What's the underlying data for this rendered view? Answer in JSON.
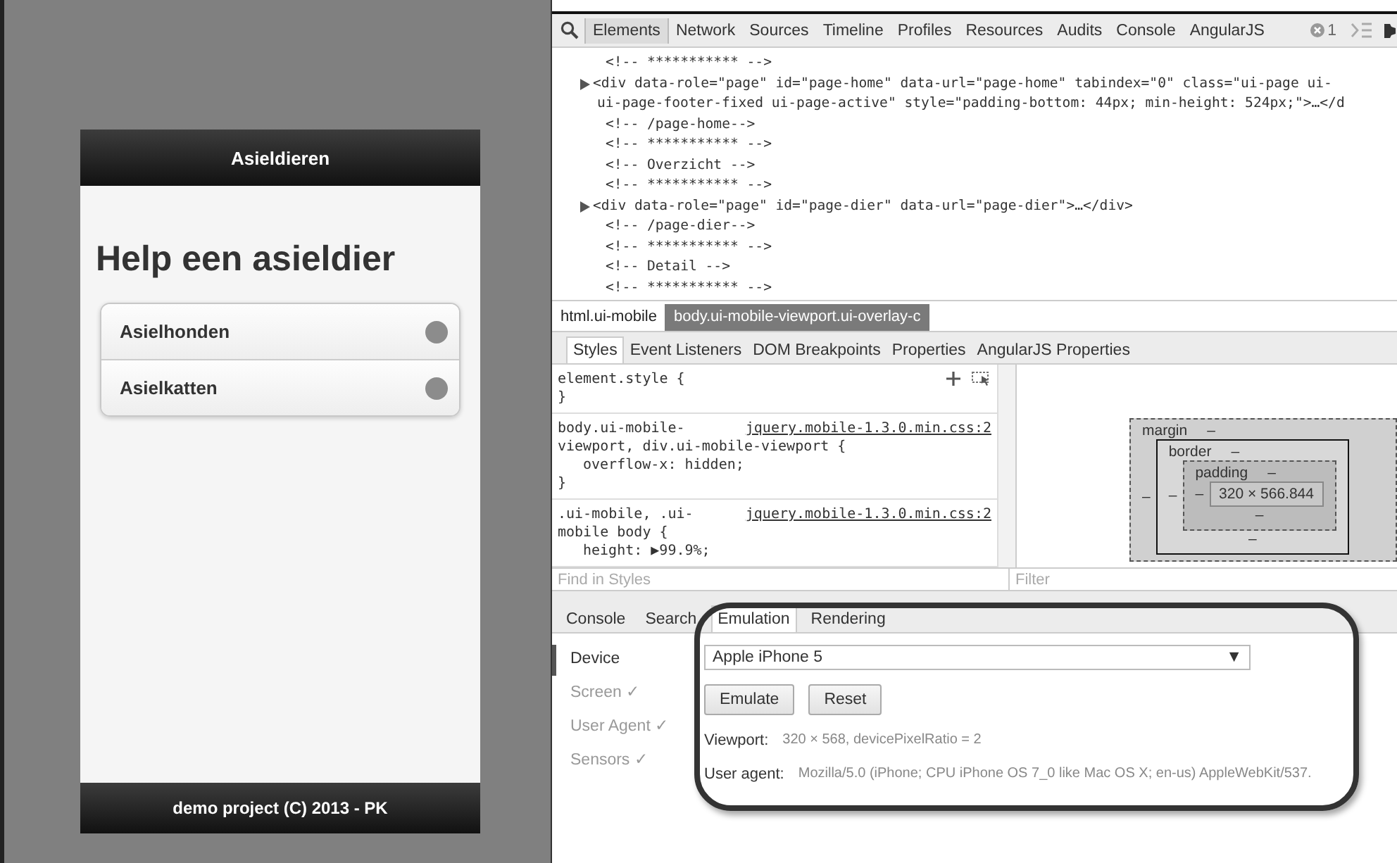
{
  "app": {
    "header_title": "Asieldieren",
    "heading": "Help een asieldier",
    "list": [
      {
        "label": "Asielhonden"
      },
      {
        "label": "Asielkatten"
      }
    ],
    "footer": "demo project (C) 2013 - PK"
  },
  "devtools": {
    "tabs": [
      {
        "label": "Elements",
        "selected": true
      },
      {
        "label": "Network",
        "selected": false
      },
      {
        "label": "Sources",
        "selected": false
      },
      {
        "label": "Timeline",
        "selected": false
      },
      {
        "label": "Profiles",
        "selected": false
      },
      {
        "label": "Resources",
        "selected": false
      },
      {
        "label": "Audits",
        "selected": false
      },
      {
        "label": "Console",
        "selected": false
      },
      {
        "label": "AngularJS",
        "selected": false
      }
    ],
    "error_count": "1",
    "dom_lines": [
      {
        "kind": "comment",
        "text": "<!-- *********** -->"
      },
      {
        "kind": "element",
        "text": "<div data-role=\"page\" id=\"page-home\" data-url=\"page-home\" tabindex=\"0\" class=\"ui-page ui-"
      },
      {
        "kind": "continuation",
        "text": "ui-page-footer-fixed ui-page-active\" style=\"padding-bottom: 44px; min-height: 524px;\">…</d"
      },
      {
        "kind": "comment",
        "text": "<!-- /page-home-->"
      },
      {
        "kind": "comment",
        "text": "<!-- *********** -->"
      },
      {
        "kind": "comment",
        "text": "<!-- Overzicht -->"
      },
      {
        "kind": "comment",
        "text": "<!-- *********** -->"
      },
      {
        "kind": "element",
        "text": "<div data-role=\"page\" id=\"page-dier\" data-url=\"page-dier\">…</div>"
      },
      {
        "kind": "comment",
        "text": "<!-- /page-dier-->"
      },
      {
        "kind": "comment",
        "text": "<!-- *********** -->"
      },
      {
        "kind": "comment",
        "text": "<!-- Detail -->"
      },
      {
        "kind": "comment",
        "text": "<!-- *********** -->"
      }
    ],
    "breadcrumbs": [
      {
        "label": "html.ui-mobile",
        "selected": false
      },
      {
        "label": "body.ui-mobile-viewport.ui-overlay-c",
        "selected": true
      }
    ],
    "sidebar_tabs": [
      {
        "label": "Styles",
        "selected": true
      },
      {
        "label": "Event Listeners",
        "selected": false
      },
      {
        "label": "DOM Breakpoints",
        "selected": false
      },
      {
        "label": "Properties",
        "selected": false
      },
      {
        "label": "AngularJS Properties",
        "selected": false
      }
    ],
    "style_rules": [
      {
        "selector_lines": [
          "element.style {"
        ],
        "close": "}",
        "tools": true
      },
      {
        "selector_lines": [
          "body.ui-mobile-",
          "viewport, div.ui-mobile-viewport {"
        ],
        "source": "jquery.mobile-1.3.0.min.css:2",
        "declarations": [
          "overflow-x: hidden;"
        ],
        "close": "}"
      },
      {
        "selector_lines": [
          ".ui-mobile, .ui-",
          "mobile body {"
        ],
        "source": "jquery.mobile-1.3.0.min.css:2",
        "declarations": [
          "height: ▶99.9%;"
        ]
      }
    ],
    "box_model": {
      "margin": "margin",
      "margin_top": "–",
      "border": "border",
      "border_top": "–",
      "border_bottom": "–",
      "padding": "padding",
      "padding_top": "–",
      "padding_bottom": "–",
      "content": "320 × 566.844",
      "sides": [
        "–",
        "–",
        "–"
      ]
    },
    "find_placeholder": "Find in Styles",
    "filter_placeholder": "Filter",
    "drawer_tabs": [
      {
        "label": "Console",
        "selected": false
      },
      {
        "label": "Search",
        "selected": false
      },
      {
        "label": "Emulation",
        "selected": true
      },
      {
        "label": "Rendering",
        "selected": false
      }
    ],
    "emulation": {
      "sections": [
        {
          "label": "Device",
          "selected": true
        },
        {
          "label": "Screen ✓",
          "selected": false
        },
        {
          "label": "User Agent ✓",
          "selected": false
        },
        {
          "label": "Sensors ✓",
          "selected": false
        }
      ],
      "device": "Apple iPhone 5",
      "caret": "▼",
      "buttons": [
        "Emulate",
        "Reset"
      ],
      "info": [
        {
          "label": "Viewport:",
          "value": "320 × 568, devicePixelRatio = 2"
        },
        {
          "label": "User agent:",
          "value": "Mozilla/5.0 (iPhone; CPU iPhone OS 7_0 like Mac OS X; en-us) AppleWebKit/537."
        }
      ]
    }
  }
}
